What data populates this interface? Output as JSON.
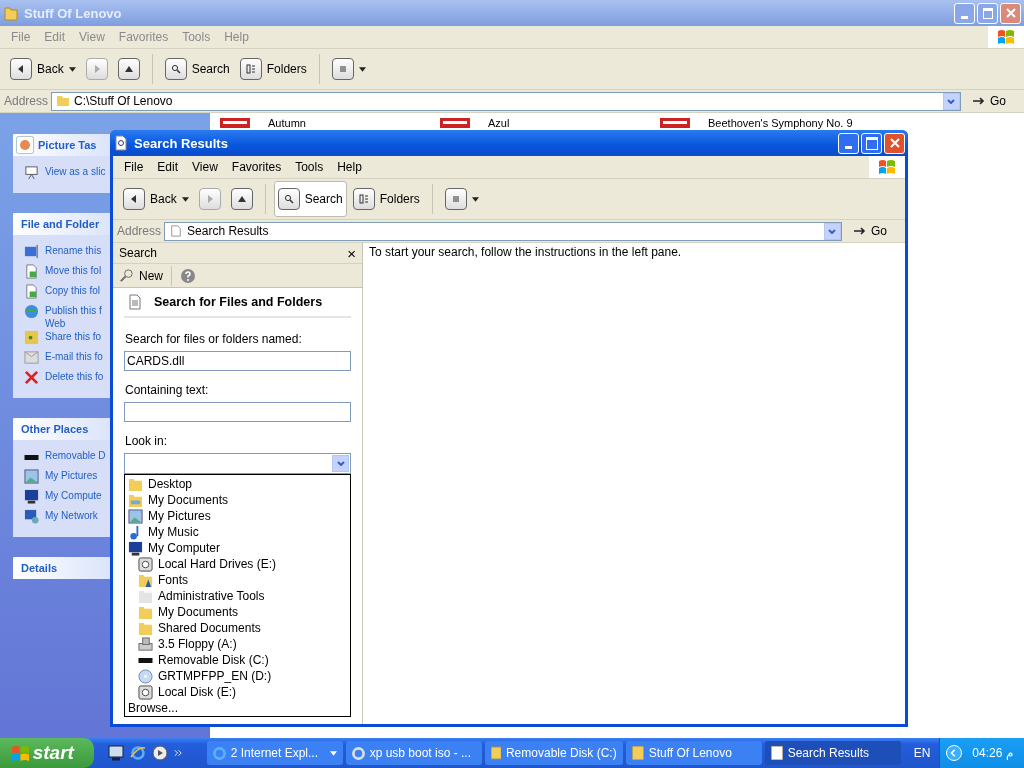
{
  "background_window": {
    "title": "Stuff Of Lenovo",
    "menu": [
      "File",
      "Edit",
      "View",
      "Favorites",
      "Tools",
      "Help"
    ],
    "toolbar": {
      "back": "Back",
      "search": "Search",
      "folders": "Folders",
      "search_pressed": false
    },
    "address": {
      "label": "Address",
      "value": "C:\\Stuff Of Lenovo",
      "go": "Go"
    },
    "task_panels": [
      {
        "title": "Picture Tas",
        "items": [
          "View as a slic"
        ]
      },
      {
        "title": "File and Folder",
        "items": [
          "Rename this",
          "Move this fol",
          "Copy this fol",
          "Publish this f\nWeb",
          "Share this fo",
          "E-mail this fo",
          "Delete this fo"
        ]
      },
      {
        "title": "Other Places",
        "items": [
          "Removable D",
          "My Pictures",
          "My Compute",
          "My Network"
        ]
      },
      {
        "title": "Details"
      }
    ],
    "files": [
      "Autumn",
      "Azul",
      "Beethoven's Symphony No. 9"
    ]
  },
  "search_window": {
    "title": "Search Results",
    "menu": [
      "File",
      "Edit",
      "View",
      "Favorites",
      "Tools",
      "Help"
    ],
    "toolbar": {
      "back": "Back",
      "search": "Search",
      "folders": "Folders",
      "search_pressed": true
    },
    "address": {
      "label": "Address",
      "value": "Search Results",
      "go": "Go"
    },
    "search_pane": {
      "title": "Search",
      "close": "×",
      "new": "New",
      "heading": "Search for Files and Folders",
      "name_label": "Search for files or folders named:",
      "name_value": "CARDS.dll",
      "text_label": "Containing text:",
      "look_in_label": "Look in:",
      "look_in_options": [
        {
          "label": "Desktop"
        },
        {
          "label": "My Documents"
        },
        {
          "label": "My Pictures"
        },
        {
          "label": "My Music"
        },
        {
          "label": "My Computer",
          "children": [
            {
              "label": "Local Hard Drives (E:)"
            },
            {
              "label": "Fonts"
            },
            {
              "label": "Administrative Tools"
            },
            {
              "label": "My Documents"
            },
            {
              "label": "Shared Documents"
            },
            {
              "label": "3.5 Floppy (A:)"
            },
            {
              "label": "Removable Disk (C:)"
            },
            {
              "label": "GRTMPFPP_EN (D:)"
            },
            {
              "label": "Local Disk (E:)"
            }
          ]
        }
      ],
      "browse": "Browse..."
    },
    "message": "To start your search, follow the instructions in the left pane."
  },
  "taskbar": {
    "start": "start",
    "tasks": [
      {
        "label": "2 Internet Expl...",
        "selected": false
      },
      {
        "label": "xp usb boot iso - ...",
        "selected": false
      },
      {
        "label": "Removable Disk (C:)",
        "selected": false
      },
      {
        "label": "Stuff Of Lenovo",
        "selected": false
      },
      {
        "label": "Search Results",
        "selected": true
      }
    ],
    "language": "EN",
    "clock": "04:26 م"
  }
}
